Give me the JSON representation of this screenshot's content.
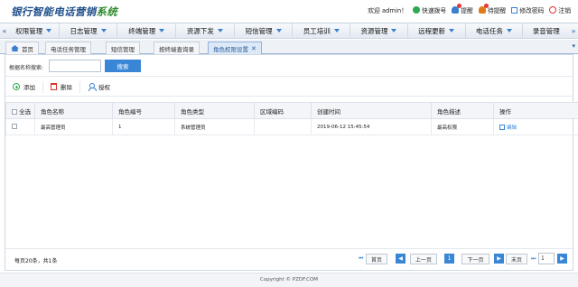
{
  "app": {
    "title_main": "银行智能电话营销",
    "title_accent": "系统"
  },
  "top_links": {
    "welcome": "欢迎 admin！",
    "quick_dial": "快速拨号",
    "reminder": "提醒",
    "pending_reminder": "待提醒",
    "change_password": "修改密码",
    "logout": "注销"
  },
  "nav": {
    "items": [
      "权限管理",
      "日志管理",
      "终端管理",
      "资源下发",
      "短信管理",
      "员工培训",
      "资源管理",
      "远程更新",
      "电话任务",
      "录音管理"
    ]
  },
  "tabs": {
    "items": [
      "首页",
      "电话任务管理",
      "短信管理",
      "按终端查询录",
      "角色权限设置"
    ],
    "active_index": 4
  },
  "search": {
    "label": "根据名称搜索:",
    "value": "",
    "placeholder": "",
    "button": "搜索"
  },
  "toolbar": {
    "add": "添加",
    "delete": "删除",
    "authorize": "授权"
  },
  "table": {
    "headers": [
      "全选",
      "角色名称",
      "角色编号",
      "角色类型",
      "区域编码",
      "创建时间",
      "角色描述",
      "操作"
    ],
    "rows": [
      {
        "name": "最高管理员",
        "code": "1",
        "type": "系统管理员",
        "area": "",
        "created": "2019-06-12 15:45:54",
        "desc": "最高权限",
        "action": "编辑"
      }
    ]
  },
  "pager": {
    "info": "每页20条，共1条",
    "first": "首页",
    "prev": "上一页",
    "current": "1",
    "next": "下一页",
    "last": "末页",
    "page_input": "1"
  },
  "footer": {
    "copyright": "Copyright © PZDF.COM"
  },
  "colors": {
    "accent": "#3a86d6",
    "brand": "#1f4f8b",
    "brand_accent": "#2e8b2e"
  }
}
